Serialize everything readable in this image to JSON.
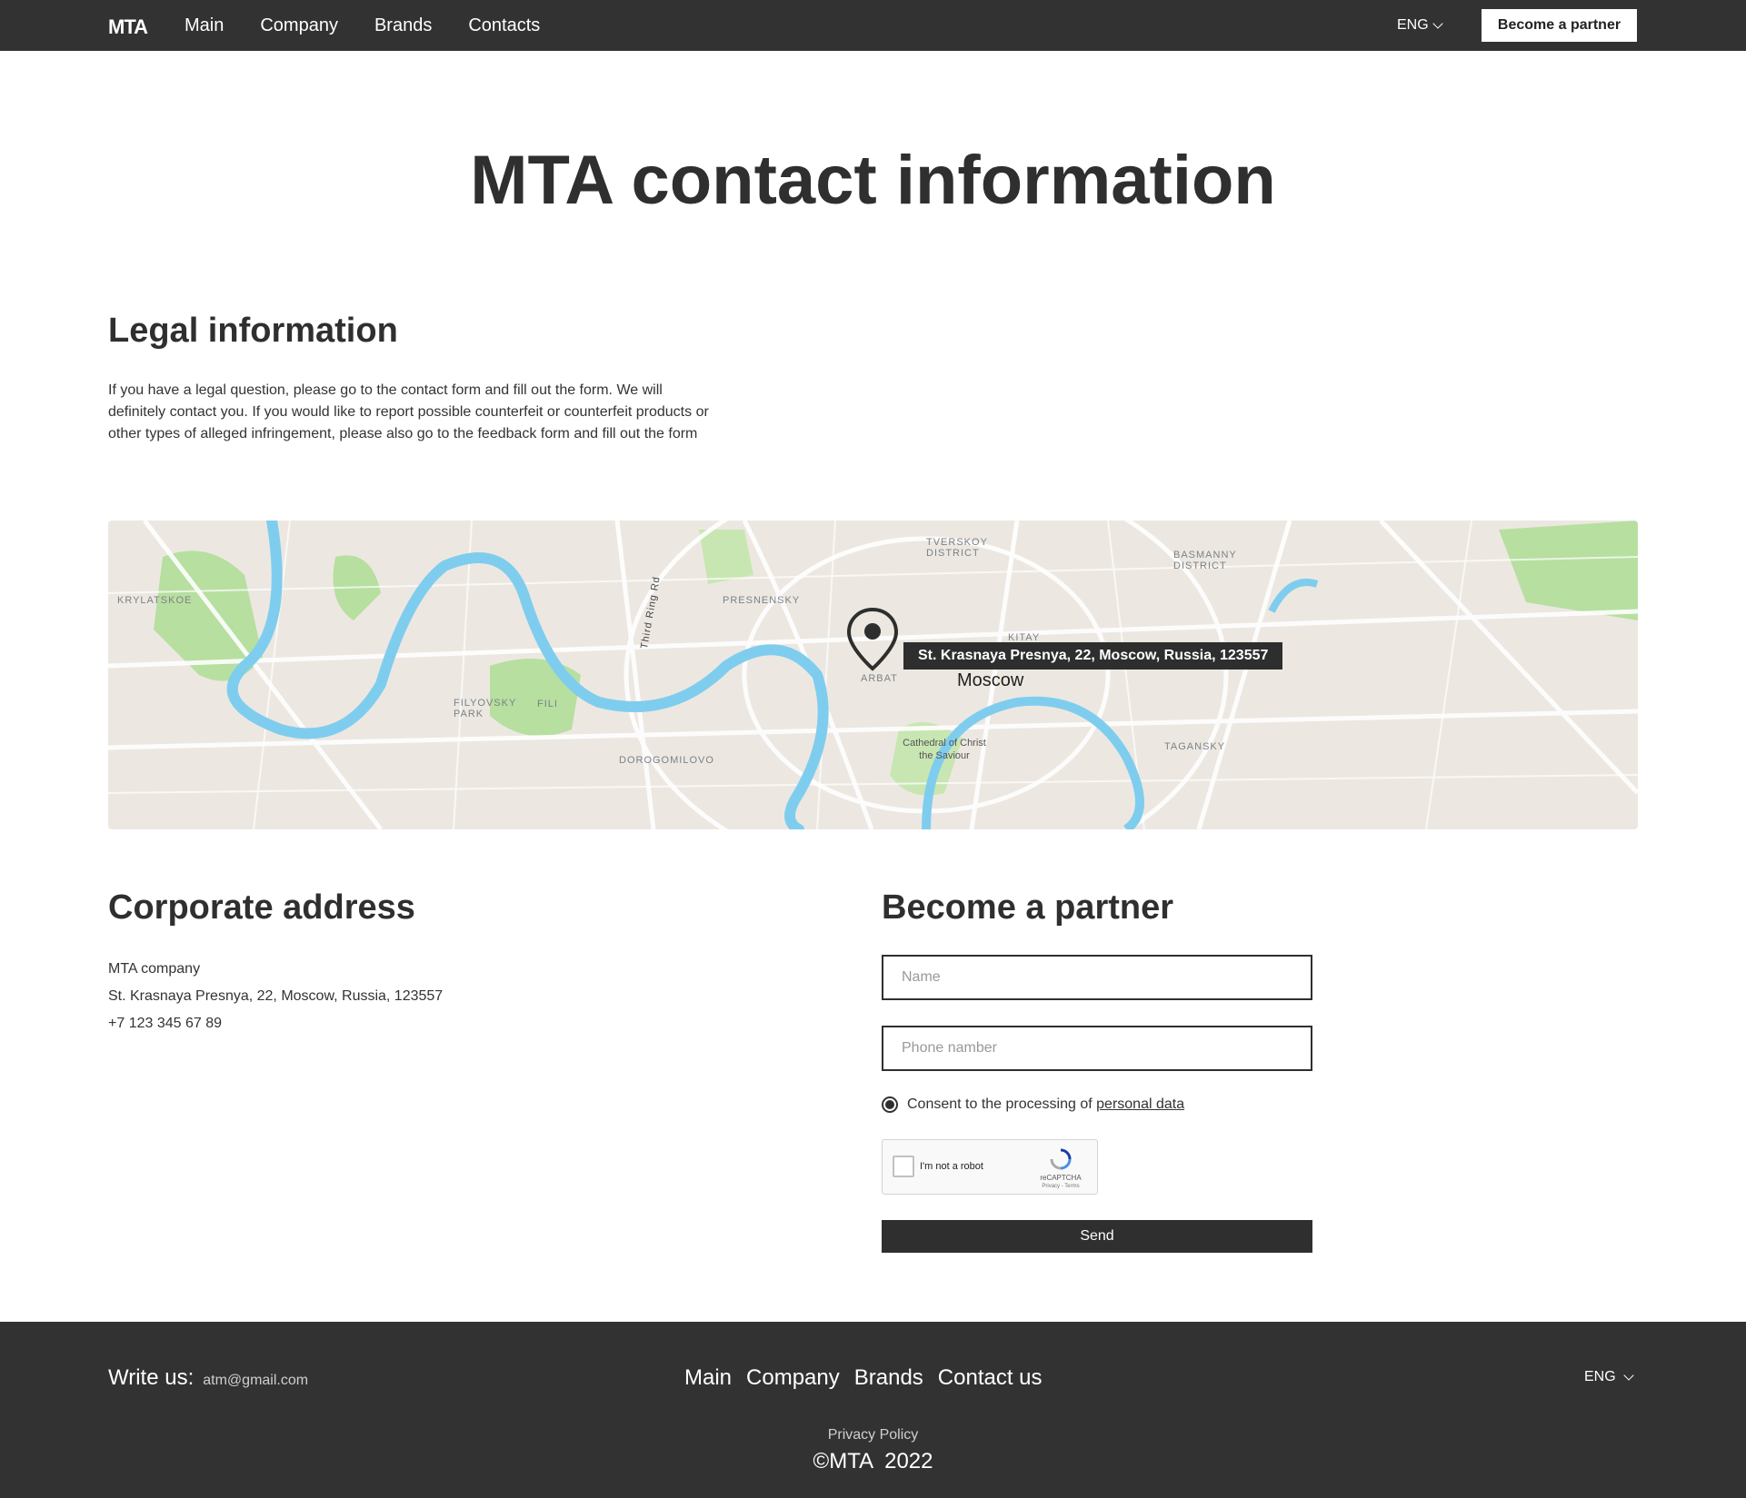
{
  "header": {
    "logo": "MTA",
    "nav": [
      "Main",
      "Company",
      "Brands",
      "Contacts"
    ],
    "lang": "ENG",
    "cta": "Become a partner"
  },
  "page": {
    "title": "MTA contact information"
  },
  "legal": {
    "title": "Legal information",
    "text": "If you have a legal question, please go to the contact form and fill out the form. We will definitely contact you. If you would like to report possible counterfeit or counterfeit products or other types of alleged infringement, please also go to the feedback form and fill out the form"
  },
  "map": {
    "tooltip": "St. Krasnaya Presnya, 22, Moscow, Russia, 123557",
    "city": "Moscow",
    "districts": [
      "PRESNENSKY",
      "ARBAT",
      "FILYOVSKY PARK",
      "FILI",
      "DOROGOMILOVO",
      "TVERSKOY DISTRICT",
      "BASMANNY DISTRICT",
      "KITAY",
      "TAGANSKY",
      "KRYLATSKOE"
    ],
    "road": "Third Ring Rd",
    "landmark": "Cathedral of Christ the Saviour"
  },
  "corporate": {
    "title": "Corporate address",
    "company": "MTA company",
    "address": "St. Krasnaya Presnya, 22, Moscow, Russia, 123557",
    "phone": "+7 123 345 67 89"
  },
  "form": {
    "title": "Become a partner",
    "name_placeholder": "Name",
    "phone_placeholder": "Phone namber",
    "consent_text": "Consent to the processing of",
    "consent_link": "personal data",
    "captcha_label": "I'm not a robot",
    "captcha_brand": "reCAPTCHA",
    "captcha_terms": "Privacy - Terms",
    "send": "Send"
  },
  "footer": {
    "write_us": "Write us:",
    "email": "atm@gmail.com",
    "nav": [
      "Main",
      "Company",
      "Brands",
      "Contact us"
    ],
    "lang": "ENG",
    "privacy": "Privacy Policy",
    "copyright": "©MTA  2022"
  },
  "colors": {
    "dark": "#323232",
    "water": "#7fcdee",
    "park": "#b7dfa0",
    "land": "#ece8e1"
  }
}
